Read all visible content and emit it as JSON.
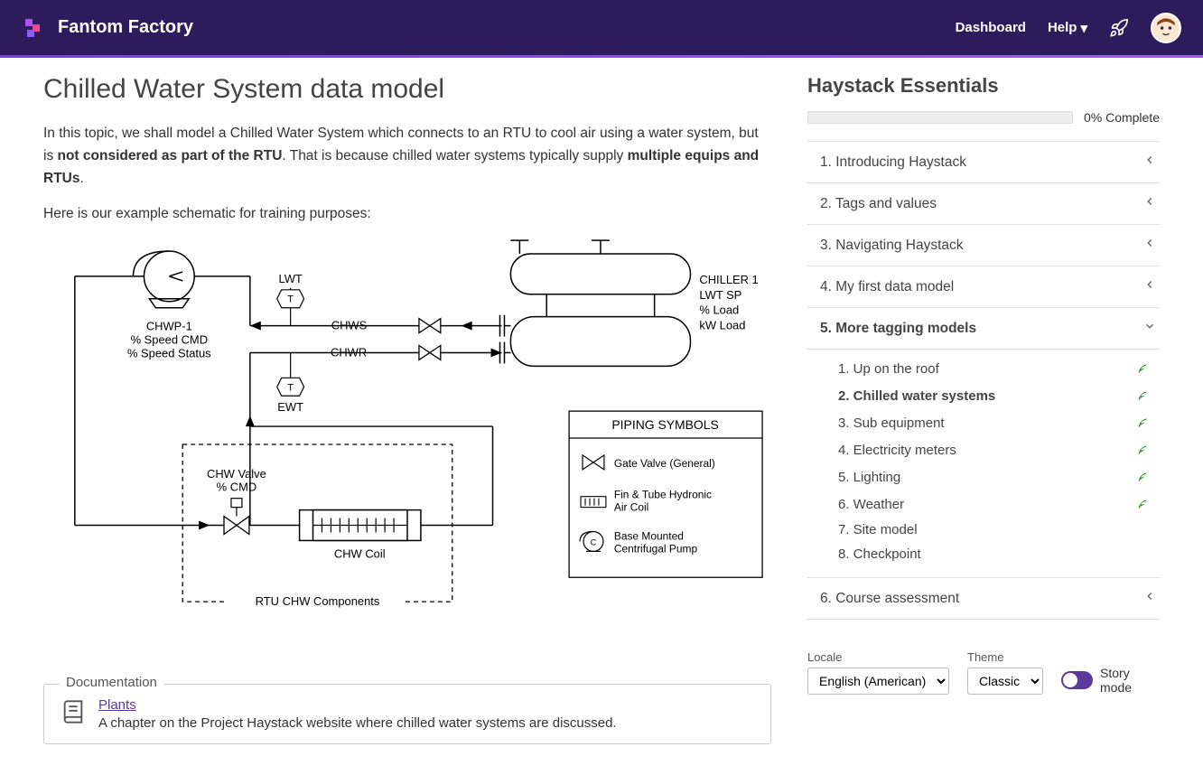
{
  "brand": "Fantom Factory",
  "nav": {
    "dashboard": "Dashboard",
    "help": "Help"
  },
  "page": {
    "title": "Chilled Water System data model",
    "intro_pre": "In this topic, we shall model a Chilled Water System which connects to an RTU to cool air using a water system, but is ",
    "intro_bold1": "not considered as part of the RTU",
    "intro_mid": ". That is because chilled water systems typically supply ",
    "intro_bold2": "multiple equips and RTUs",
    "intro_end": ".",
    "subtext": "Here is our example schematic for training purposes:"
  },
  "diagram": {
    "pump_label1": "CHWP-1",
    "pump_label2": "% Speed CMD",
    "pump_label3": "% Speed Status",
    "lwt": "LWT",
    "ewt": "EWT",
    "t": "T",
    "chws": "CHWS",
    "chwr": "CHWR",
    "chiller1": "CHILLER 1",
    "chiller2": "LWT SP",
    "chiller3": "% Load",
    "chiller4": "kW Load",
    "valve1": "CHW Valve",
    "valve2": "% CMD",
    "coil": "CHW Coil",
    "rtu_label": "RTU CHW Components",
    "legend_title": "PIPING SYMBOLS",
    "legend1": "Gate Valve (General)",
    "legend2a": "Fin & Tube Hydronic",
    "legend2b": "Air Coil",
    "legend3a": "Base Mounted",
    "legend3b": "Centrifugal Pump"
  },
  "doc": {
    "legend": "Documentation",
    "link": "Plants",
    "desc": "A chapter on the Project Haystack website where chilled water systems are discussed."
  },
  "course": {
    "title": "Haystack Essentials",
    "progress": "0% Complete",
    "sections": [
      {
        "label": "1. Introducing Haystack"
      },
      {
        "label": "2. Tags and values"
      },
      {
        "label": "3. Navigating Haystack"
      },
      {
        "label": "4. My first data model"
      },
      {
        "label": "5. More tagging models",
        "expanded": true
      },
      {
        "label": "6. Course assessment"
      }
    ],
    "sub": [
      {
        "label": "1. Up on the roof",
        "leaf": true
      },
      {
        "label": "2. Chilled water systems",
        "leaf": true,
        "current": true
      },
      {
        "label": "3. Sub equipment",
        "leaf": true
      },
      {
        "label": "4. Electricity meters",
        "leaf": true
      },
      {
        "label": "5. Lighting",
        "leaf": true
      },
      {
        "label": "6. Weather",
        "leaf": true
      },
      {
        "label": "7. Site model",
        "leaf": false
      },
      {
        "label": "8. Checkpoint",
        "leaf": false
      }
    ]
  },
  "settings": {
    "locale_label": "Locale",
    "locale_value": "English (American)",
    "theme_label": "Theme",
    "theme_value": "Classic",
    "story_mode": "Story mode"
  }
}
